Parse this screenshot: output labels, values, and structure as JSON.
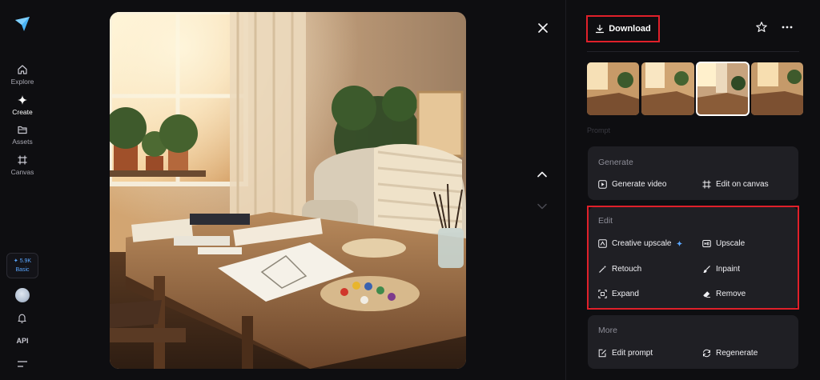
{
  "sidebar": {
    "items": [
      {
        "label": "Explore",
        "icon": "home-icon",
        "active": false
      },
      {
        "label": "Create",
        "icon": "sparkle-icon",
        "active": true
      },
      {
        "label": "Assets",
        "icon": "folder-icon",
        "active": false
      },
      {
        "label": "Canvas",
        "icon": "frame-icon",
        "active": false
      }
    ],
    "credits": {
      "amount": "5.9K",
      "plan": "Basic"
    },
    "api_label": "API"
  },
  "toolbar": {
    "download_label": "Download"
  },
  "panel": {
    "prompt_label": "Prompt",
    "generate": {
      "title": "Generate",
      "actions": [
        {
          "label": "Generate video",
          "icon": "play-icon"
        },
        {
          "label": "Edit on canvas",
          "icon": "frame-icon"
        }
      ]
    },
    "edit": {
      "title": "Edit",
      "actions": [
        {
          "label": "Creative upscale",
          "icon": "upscale-icon"
        },
        {
          "label": "Upscale",
          "icon": "hd-icon"
        },
        {
          "label": "Retouch",
          "icon": "magic-wand-icon"
        },
        {
          "label": "Inpaint",
          "icon": "brush-icon"
        },
        {
          "label": "Expand",
          "icon": "expand-icon"
        },
        {
          "label": "Remove",
          "icon": "eraser-icon"
        }
      ]
    },
    "more": {
      "title": "More",
      "actions": [
        {
          "label": "Edit prompt",
          "icon": "edit-prompt-icon"
        },
        {
          "label": "Regenerate",
          "icon": "regenerate-icon"
        }
      ]
    }
  },
  "colors": {
    "accent_blue": "#5aa7ff",
    "highlight_red": "#e0202a",
    "card_bg": "#1f1f24",
    "page_bg": "#0e0e11"
  }
}
